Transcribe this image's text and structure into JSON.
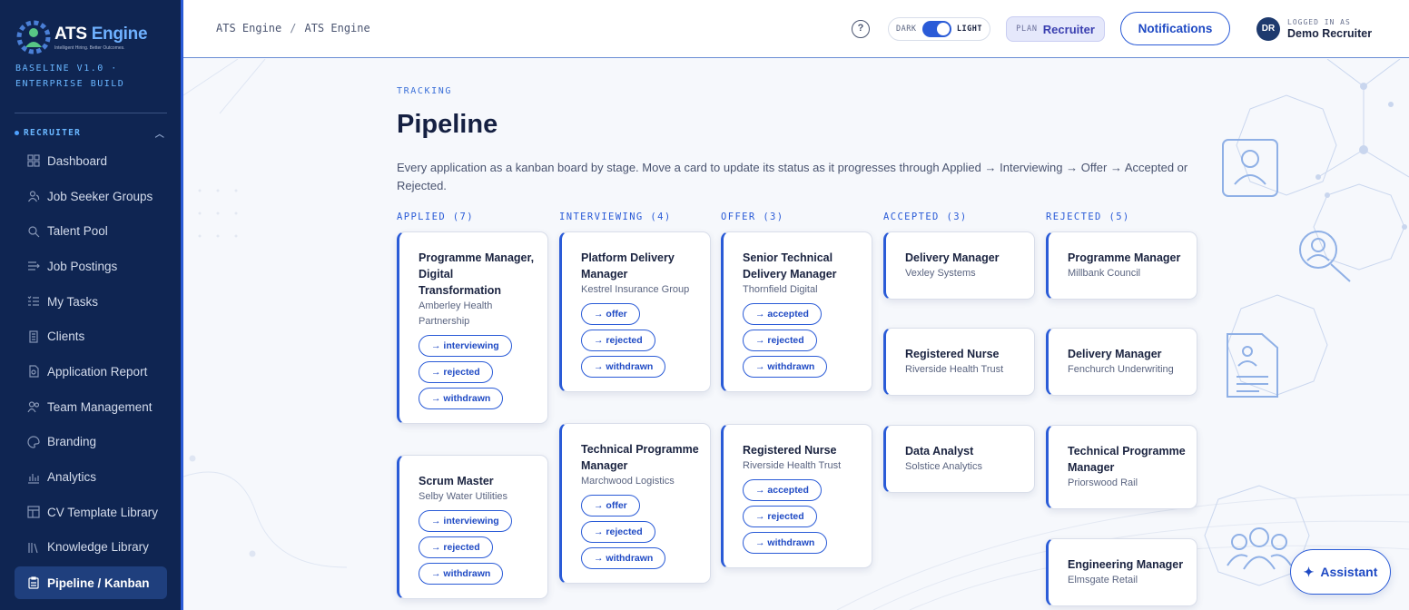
{
  "brand": {
    "name_main": "ATS",
    "name_accent": "Engine",
    "tagline": "Intelligent Hiring. Better Outcomes.",
    "build": "BASELINE V1.0 · ENTERPRISE BUILD"
  },
  "sidebar": {
    "section": "RECRUITER",
    "items": [
      {
        "label": "Dashboard",
        "icon": "dashboard-icon"
      },
      {
        "label": "Job Seeker Groups",
        "icon": "users-icon"
      },
      {
        "label": "Talent Pool",
        "icon": "search-icon"
      },
      {
        "label": "Job Postings",
        "icon": "postings-icon"
      },
      {
        "label": "My Tasks",
        "icon": "tasks-icon"
      },
      {
        "label": "Clients",
        "icon": "building-icon"
      },
      {
        "label": "Application Report",
        "icon": "report-icon"
      },
      {
        "label": "Team Management",
        "icon": "team-icon"
      },
      {
        "label": "Branding",
        "icon": "palette-icon"
      },
      {
        "label": "Analytics",
        "icon": "chart-icon"
      },
      {
        "label": "CV Template Library",
        "icon": "template-icon"
      },
      {
        "label": "Knowledge Library",
        "icon": "library-icon"
      },
      {
        "label": "Pipeline / Kanban",
        "icon": "clipboard-icon",
        "active": true
      }
    ]
  },
  "topbar": {
    "breadcrumb": [
      "ATS Engine",
      "ATS Engine"
    ],
    "crumb_sep": "/",
    "help": "?",
    "theme_dark": "DARK",
    "theme_light": "LIGHT",
    "plan_key": "PLAN",
    "plan_value": "Recruiter",
    "notifications": "Notifications",
    "avatar": "DR",
    "logged_in_key": "LOGGED IN AS",
    "logged_in_name": "Demo Recruiter"
  },
  "page": {
    "eyebrow": "TRACKING",
    "title": "Pipeline",
    "description": "Every application as a kanban board by stage. Move a card to update its status as it progresses through Applied → Interviewing → Offer → Accepted or Rejected."
  },
  "columns": [
    {
      "title": "APPLIED (7)",
      "cards": [
        {
          "role": "Programme Manager, Digital Transformation",
          "company": "Amberley Health Partnership",
          "actions": [
            "→ interviewing",
            "→ rejected",
            "→ withdrawn"
          ]
        },
        {
          "role": "Scrum Master",
          "company": "Selby Water Utilities",
          "actions": [
            "→ interviewing",
            "→ rejected",
            "→ withdrawn"
          ]
        }
      ]
    },
    {
      "title": "INTERVIEWING (4)",
      "cards": [
        {
          "role": "Platform Delivery Manager",
          "company": "Kestrel Insurance Group",
          "actions": [
            "→ offer",
            "→ rejected",
            "→ withdrawn"
          ]
        },
        {
          "role": "Technical Programme Manager",
          "company": "Marchwood Logistics",
          "actions": [
            "→ offer",
            "→ rejected",
            "→ withdrawn"
          ]
        }
      ]
    },
    {
      "title": "OFFER (3)",
      "cards": [
        {
          "role": "Senior Technical Delivery Manager",
          "company": "Thornfield Digital",
          "actions": [
            "→ accepted",
            "→ rejected",
            "→ withdrawn"
          ]
        },
        {
          "role": "Registered Nurse",
          "company": "Riverside Health Trust",
          "actions": [
            "→ accepted",
            "→ rejected",
            "→ withdrawn"
          ]
        }
      ]
    },
    {
      "title": "ACCEPTED (3)",
      "cards": [
        {
          "role": "Delivery Manager",
          "company": "Vexley Systems",
          "actions": []
        },
        {
          "role": "Registered Nurse",
          "company": "Riverside Health Trust",
          "actions": []
        },
        {
          "role": "Data Analyst",
          "company": "Solstice Analytics",
          "actions": []
        }
      ]
    },
    {
      "title": "REJECTED (5)",
      "cards": [
        {
          "role": "Programme Manager",
          "company": "Millbank Council",
          "actions": []
        },
        {
          "role": "Delivery Manager",
          "company": "Fenchurch Underwriting",
          "actions": []
        },
        {
          "role": "Technical Programme Manager",
          "company": "Priorswood Rail",
          "actions": []
        },
        {
          "role": "Engineering Manager",
          "company": "Elmsgate Retail",
          "actions": []
        }
      ]
    }
  ],
  "assistant": {
    "label": "Assistant",
    "icon": "sparkle-icon"
  },
  "colors": {
    "sidebar_bg": "#0f2552",
    "accent": "#2a5bd7",
    "page_bg": "#f6f8fc"
  }
}
